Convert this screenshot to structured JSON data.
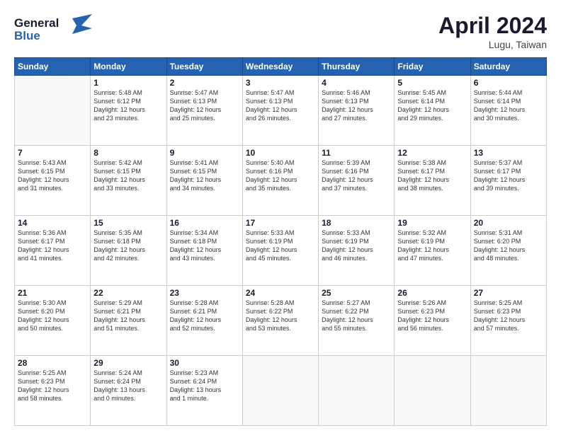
{
  "header": {
    "logo_line1": "General",
    "logo_line2": "Blue",
    "month": "April 2024",
    "location": "Lugu, Taiwan"
  },
  "weekdays": [
    "Sunday",
    "Monday",
    "Tuesday",
    "Wednesday",
    "Thursday",
    "Friday",
    "Saturday"
  ],
  "weeks": [
    [
      {
        "day": "",
        "info": ""
      },
      {
        "day": "1",
        "info": "Sunrise: 5:48 AM\nSunset: 6:12 PM\nDaylight: 12 hours\nand 23 minutes."
      },
      {
        "day": "2",
        "info": "Sunrise: 5:47 AM\nSunset: 6:13 PM\nDaylight: 12 hours\nand 25 minutes."
      },
      {
        "day": "3",
        "info": "Sunrise: 5:47 AM\nSunset: 6:13 PM\nDaylight: 12 hours\nand 26 minutes."
      },
      {
        "day": "4",
        "info": "Sunrise: 5:46 AM\nSunset: 6:13 PM\nDaylight: 12 hours\nand 27 minutes."
      },
      {
        "day": "5",
        "info": "Sunrise: 5:45 AM\nSunset: 6:14 PM\nDaylight: 12 hours\nand 29 minutes."
      },
      {
        "day": "6",
        "info": "Sunrise: 5:44 AM\nSunset: 6:14 PM\nDaylight: 12 hours\nand 30 minutes."
      }
    ],
    [
      {
        "day": "7",
        "info": "Sunrise: 5:43 AM\nSunset: 6:15 PM\nDaylight: 12 hours\nand 31 minutes."
      },
      {
        "day": "8",
        "info": "Sunrise: 5:42 AM\nSunset: 6:15 PM\nDaylight: 12 hours\nand 33 minutes."
      },
      {
        "day": "9",
        "info": "Sunrise: 5:41 AM\nSunset: 6:15 PM\nDaylight: 12 hours\nand 34 minutes."
      },
      {
        "day": "10",
        "info": "Sunrise: 5:40 AM\nSunset: 6:16 PM\nDaylight: 12 hours\nand 35 minutes."
      },
      {
        "day": "11",
        "info": "Sunrise: 5:39 AM\nSunset: 6:16 PM\nDaylight: 12 hours\nand 37 minutes."
      },
      {
        "day": "12",
        "info": "Sunrise: 5:38 AM\nSunset: 6:17 PM\nDaylight: 12 hours\nand 38 minutes."
      },
      {
        "day": "13",
        "info": "Sunrise: 5:37 AM\nSunset: 6:17 PM\nDaylight: 12 hours\nand 39 minutes."
      }
    ],
    [
      {
        "day": "14",
        "info": "Sunrise: 5:36 AM\nSunset: 6:17 PM\nDaylight: 12 hours\nand 41 minutes."
      },
      {
        "day": "15",
        "info": "Sunrise: 5:35 AM\nSunset: 6:18 PM\nDaylight: 12 hours\nand 42 minutes."
      },
      {
        "day": "16",
        "info": "Sunrise: 5:34 AM\nSunset: 6:18 PM\nDaylight: 12 hours\nand 43 minutes."
      },
      {
        "day": "17",
        "info": "Sunrise: 5:33 AM\nSunset: 6:19 PM\nDaylight: 12 hours\nand 45 minutes."
      },
      {
        "day": "18",
        "info": "Sunrise: 5:33 AM\nSunset: 6:19 PM\nDaylight: 12 hours\nand 46 minutes."
      },
      {
        "day": "19",
        "info": "Sunrise: 5:32 AM\nSunset: 6:19 PM\nDaylight: 12 hours\nand 47 minutes."
      },
      {
        "day": "20",
        "info": "Sunrise: 5:31 AM\nSunset: 6:20 PM\nDaylight: 12 hours\nand 48 minutes."
      }
    ],
    [
      {
        "day": "21",
        "info": "Sunrise: 5:30 AM\nSunset: 6:20 PM\nDaylight: 12 hours\nand 50 minutes."
      },
      {
        "day": "22",
        "info": "Sunrise: 5:29 AM\nSunset: 6:21 PM\nDaylight: 12 hours\nand 51 minutes."
      },
      {
        "day": "23",
        "info": "Sunrise: 5:28 AM\nSunset: 6:21 PM\nDaylight: 12 hours\nand 52 minutes."
      },
      {
        "day": "24",
        "info": "Sunrise: 5:28 AM\nSunset: 6:22 PM\nDaylight: 12 hours\nand 53 minutes."
      },
      {
        "day": "25",
        "info": "Sunrise: 5:27 AM\nSunset: 6:22 PM\nDaylight: 12 hours\nand 55 minutes."
      },
      {
        "day": "26",
        "info": "Sunrise: 5:26 AM\nSunset: 6:23 PM\nDaylight: 12 hours\nand 56 minutes."
      },
      {
        "day": "27",
        "info": "Sunrise: 5:25 AM\nSunset: 6:23 PM\nDaylight: 12 hours\nand 57 minutes."
      }
    ],
    [
      {
        "day": "28",
        "info": "Sunrise: 5:25 AM\nSunset: 6:23 PM\nDaylight: 12 hours\nand 58 minutes."
      },
      {
        "day": "29",
        "info": "Sunrise: 5:24 AM\nSunset: 6:24 PM\nDaylight: 13 hours\nand 0 minutes."
      },
      {
        "day": "30",
        "info": "Sunrise: 5:23 AM\nSunset: 6:24 PM\nDaylight: 13 hours\nand 1 minute."
      },
      {
        "day": "",
        "info": ""
      },
      {
        "day": "",
        "info": ""
      },
      {
        "day": "",
        "info": ""
      },
      {
        "day": "",
        "info": ""
      }
    ]
  ]
}
